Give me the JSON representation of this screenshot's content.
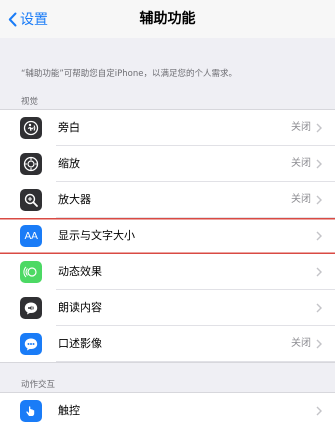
{
  "nav": {
    "back_label": "设置",
    "title": "辅助功能"
  },
  "description": "“辅助功能”可帮助您自定iPhone，以满足您的个人需求。",
  "sections": [
    {
      "header": "视觉",
      "items": [
        {
          "label": "旁白",
          "value": "关闭",
          "icon": "voiceover-icon",
          "color": "#303033"
        },
        {
          "label": "缩放",
          "value": "关闭",
          "icon": "zoom-icon",
          "color": "#303033"
        },
        {
          "label": "放大器",
          "value": "关闭",
          "icon": "magnifier-icon",
          "color": "#303033"
        },
        {
          "label": "显示与文字大小",
          "value": "",
          "icon": "text-size-icon",
          "color": "#1a7cf7",
          "highlighted": true
        },
        {
          "label": "动态效果",
          "value": "",
          "icon": "motion-icon",
          "color": "#4cd964"
        },
        {
          "label": "朗读内容",
          "value": "",
          "icon": "spoken-content-icon",
          "color": "#303033"
        },
        {
          "label": "口述影像",
          "value": "关闭",
          "icon": "audio-description-icon",
          "color": "#1a7cf7"
        }
      ]
    },
    {
      "header": "动作交互",
      "items": [
        {
          "label": "触控",
          "value": "",
          "icon": "touch-icon",
          "color": "#1a7cf7"
        }
      ]
    }
  ]
}
